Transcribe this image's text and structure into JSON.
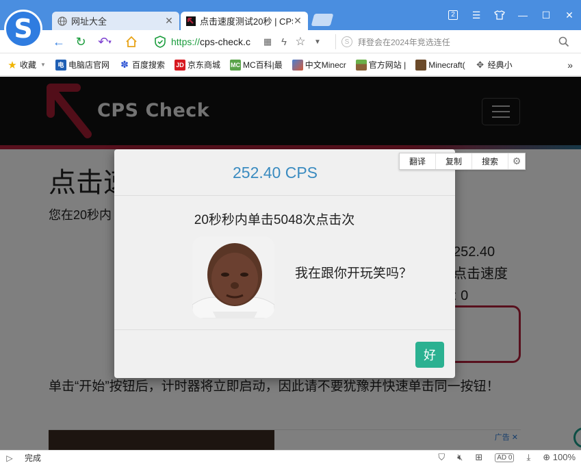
{
  "browser": {
    "tabs": [
      {
        "label": "网址大全",
        "active": false
      },
      {
        "label": "点击速度测试20秒 | CPS",
        "active": true
      }
    ],
    "window_badge": "2",
    "url_https": "https://",
    "url_host": "cps-check.c",
    "search_placeholder": "拜登会在2024年竞选连任",
    "bookmarks": [
      {
        "label": "收藏",
        "icon": "star-icon"
      },
      {
        "label": "电脑店官网",
        "icon": "computer-store-icon"
      },
      {
        "label": "百度搜索",
        "icon": "baidu-paw-icon"
      },
      {
        "label": "京东商城",
        "icon": "jd-icon",
        "icon_text": "JD"
      },
      {
        "label": "MC百科|最",
        "icon": "mc-wiki-icon",
        "icon_text": "MC"
      },
      {
        "label": "中文Minecr",
        "icon": "minecraft-cube-icon"
      },
      {
        "label": "官方网站 |",
        "icon": "grass-block-icon"
      },
      {
        "label": "Minecraft(",
        "icon": "minecraft-block-icon"
      },
      {
        "label": "经典小",
        "icon": "classic-games-icon"
      }
    ],
    "status_text": "完成",
    "zoom": "100%",
    "status_badge": "0"
  },
  "page": {
    "brand": "CPS Check",
    "heading": "点击速",
    "subtitle": "您在20秒内",
    "stats": [
      "252.40",
      "点击速度",
      ": 0"
    ],
    "instructions": "单击“开始”按钮后，计时器将立即启动，因此请不要犹豫并快速单击同一按钮！",
    "ad_label": "广告",
    "ad_close": "✕"
  },
  "modal": {
    "title": "252.40 CPS",
    "message": "20秒秒内单击5048次点击次",
    "joke": "我在跟你开玩笑吗？",
    "ok_label": "好",
    "close": "×"
  },
  "selection_toolbar": {
    "translate": "翻译",
    "copy": "复制",
    "search": "搜索"
  },
  "colors": {
    "browser_blue": "#4a8ee0",
    "accent_red": "#b0203a",
    "modal_title_blue": "#3a8bc0",
    "ok_green": "#2bb191"
  }
}
